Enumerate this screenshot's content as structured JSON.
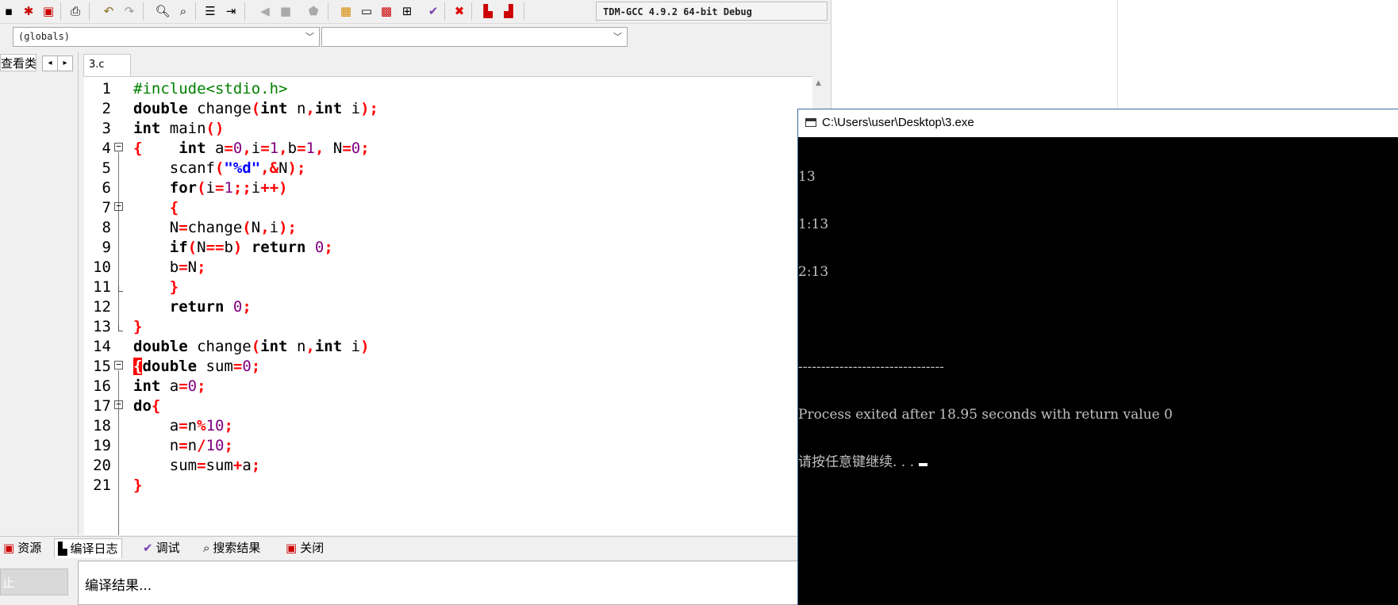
{
  "toolbar": {
    "compiler": "TDM-GCC 4.9.2 64-bit Debug"
  },
  "scope": {
    "globals": "(globals)",
    "members": ""
  },
  "sidebar": {
    "tab_label": "查看类"
  },
  "editor": {
    "file_tab": "3.c",
    "line_numbers": [
      "1",
      "2",
      "3",
      "4",
      "5",
      "6",
      "7",
      "8",
      "9",
      "10",
      "11",
      "12",
      "13",
      "14",
      "15",
      "16",
      "17",
      "18",
      "19",
      "20",
      "21"
    ],
    "lines": [
      "#include<stdio.h>",
      "double change(int n,int i);",
      "int main()",
      "{    int a=0,i=1,b=1, N=0;",
      "    scanf(\"%d\",&N);",
      "    for(i=1;;i++)",
      "    {",
      "    N=change(N,i);",
      "    if(N==b) return 0;",
      "    b=N;",
      "    }",
      "    return 0;",
      "}",
      "double change(int n,int i)",
      "{double sum=0;",
      "int a=0;",
      "do{",
      "    a=n%10;",
      "    n=n/10;",
      "    sum=sum+a;",
      "}"
    ]
  },
  "bottom_tabs": {
    "resources": "资源",
    "compile_log": "编译日志",
    "debug": "调试",
    "search_results": "搜索结果",
    "close": "关闭"
  },
  "output": {
    "stop_button": "止",
    "compile_result": "编译结果..."
  },
  "console": {
    "title": "C:\\Users\\user\\Desktop\\3.exe",
    "lines": [
      "13",
      "1:13",
      "2:13",
      "",
      "--------------------------------",
      "Process exited after 18.95 seconds with return value 0",
      "请按任意键继续. . ."
    ]
  }
}
